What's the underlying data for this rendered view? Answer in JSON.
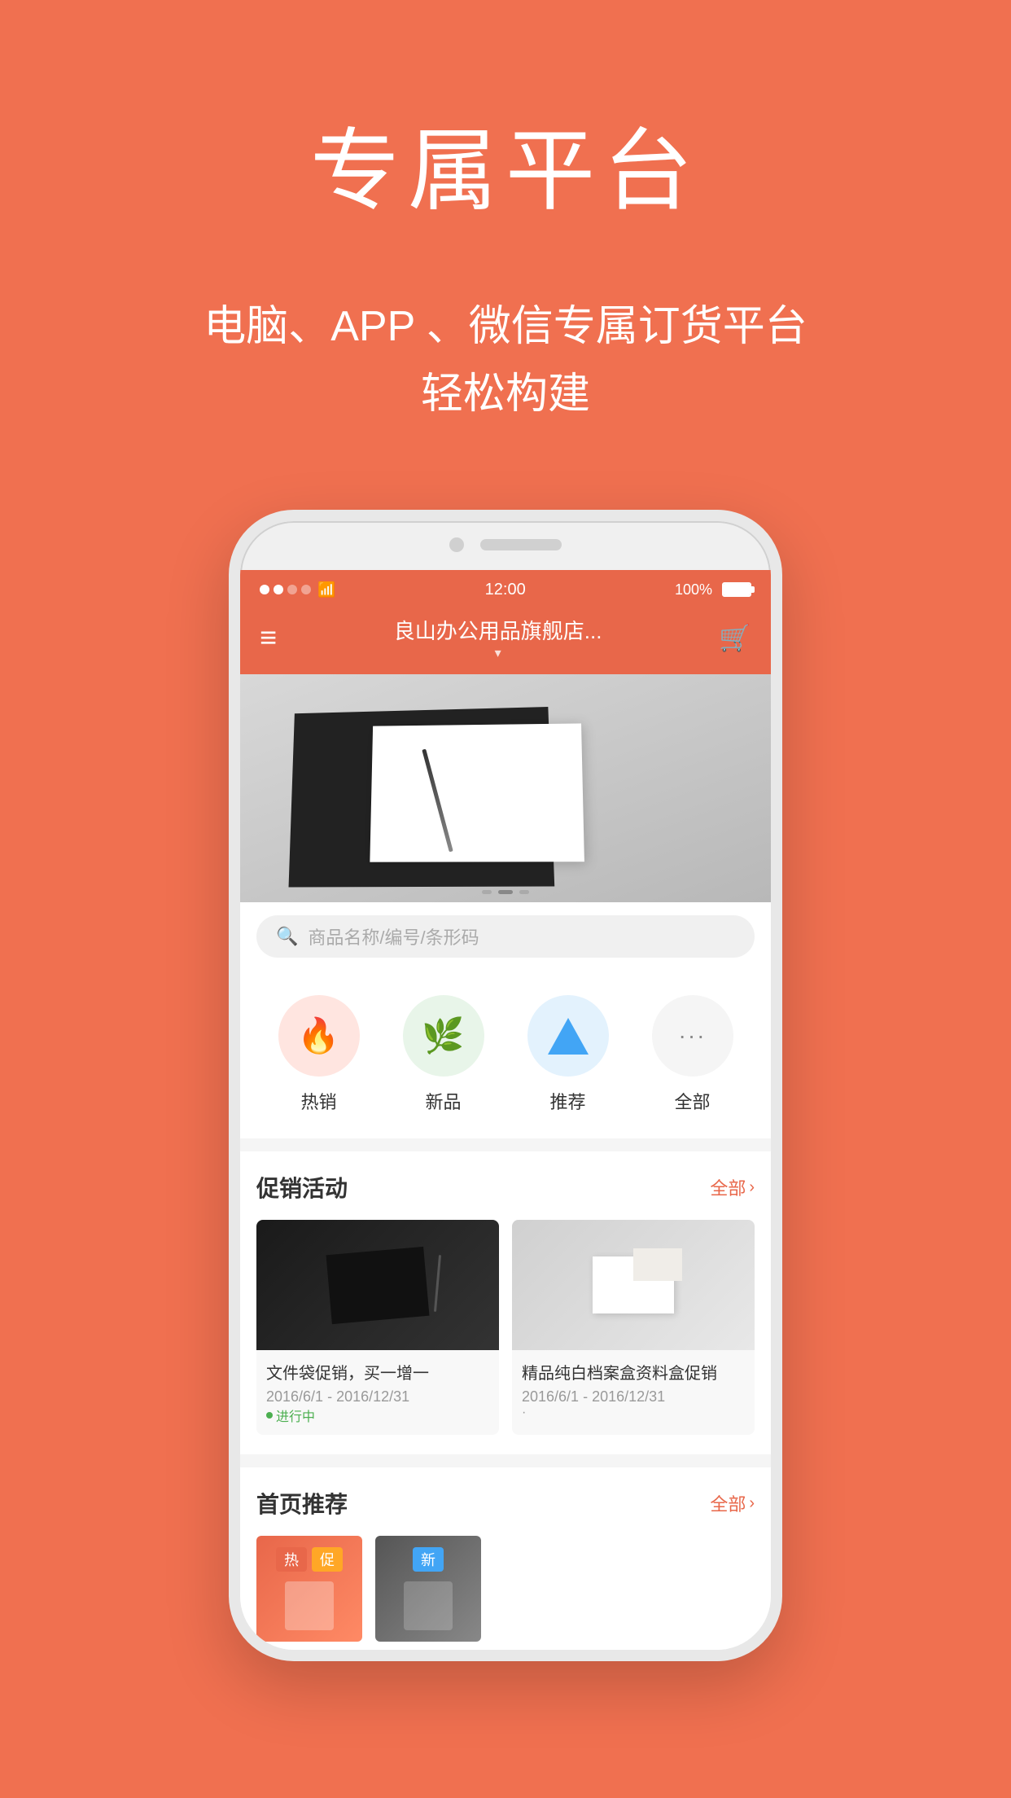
{
  "page": {
    "background_color": "#F07050"
  },
  "hero": {
    "title": "专属平台",
    "subtitle_line1": "电脑、APP 、微信专属订货平台",
    "subtitle_line2": "轻松构建"
  },
  "phone": {
    "status_bar": {
      "time": "12:00",
      "battery": "100%"
    },
    "nav": {
      "store_name": "良山办公用品旗舰店...",
      "dropdown_arrow": "▾"
    },
    "search": {
      "placeholder": "商品名称/编号/条形码"
    },
    "categories": [
      {
        "label": "热销",
        "icon": "🔥",
        "style": "hot"
      },
      {
        "label": "新品",
        "icon": "🌿",
        "style": "new"
      },
      {
        "label": "推荐",
        "icon": "▲",
        "style": "recommend"
      },
      {
        "label": "全部",
        "icon": "···",
        "style": "all"
      }
    ],
    "promotions": {
      "section_title": "促销活动",
      "more_label": "全部",
      "arrow": "›",
      "items": [
        {
          "name": "文件袋促销，买一增一",
          "date_range": "2016/6/1 - 2016/12/31",
          "status": "进行中"
        },
        {
          "name": "精品纯白档案盒资料盒促销",
          "date_range": "2016/6/1 - 2016/12/31",
          "status": "·"
        }
      ]
    },
    "recommendations": {
      "section_title": "首页推荐",
      "more_label": "全部",
      "arrow": "›",
      "tags": [
        "热",
        "促",
        "新"
      ]
    }
  }
}
